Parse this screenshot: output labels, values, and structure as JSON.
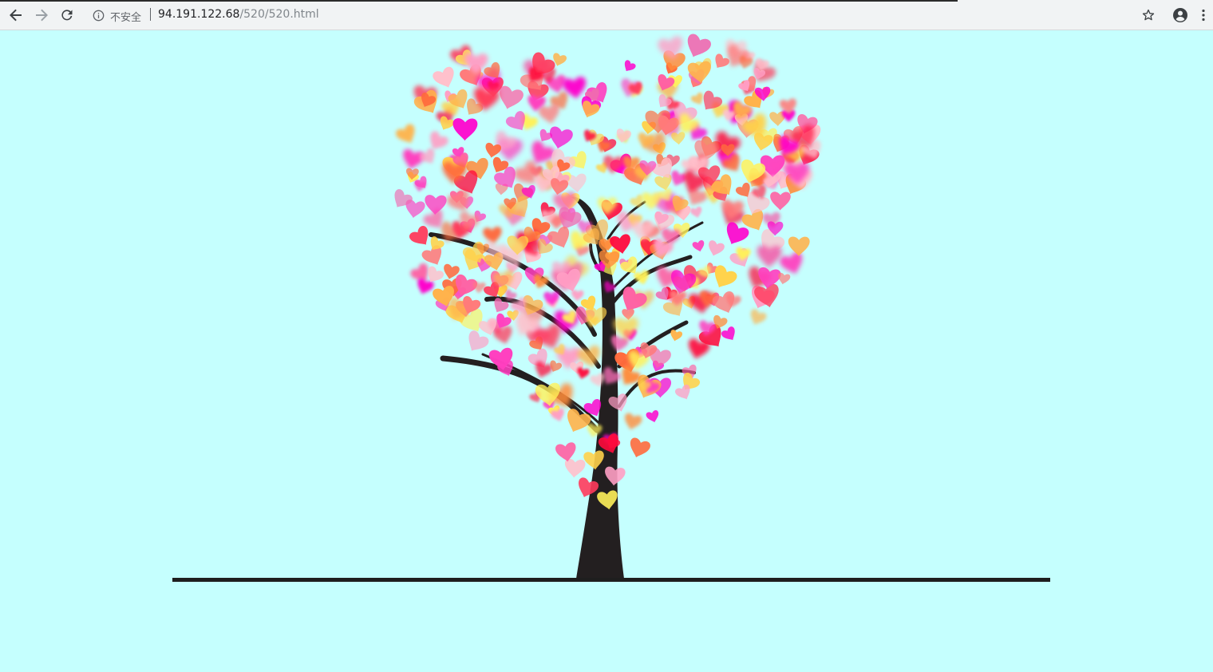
{
  "browser": {
    "security_label": "不安全",
    "url_host": "94.191.122.68",
    "url_path": "/520/520.html",
    "icons": {
      "back": "back-arrow-icon",
      "forward": "forward-arrow-icon",
      "reload": "reload-icon",
      "info": "info-icon",
      "bookmark": "star-icon",
      "profile": "account-icon",
      "menu": "kebab-menu-icon"
    }
  },
  "page": {
    "background_color": "#c5fffe",
    "trunk_color": "#231f20",
    "ground_color": "#1e1e1e",
    "heart_colors": [
      "#ff0a3c",
      "#ff3b5c",
      "#ff6a3d",
      "#ff8c3a",
      "#ffb24a",
      "#ffd24a",
      "#fff15a",
      "#ff5fa2",
      "#ff3fbf",
      "#ff00cc",
      "#ff9ec4",
      "#ffc0cb",
      "#ff7a7a",
      "#f06ab0"
    ]
  }
}
